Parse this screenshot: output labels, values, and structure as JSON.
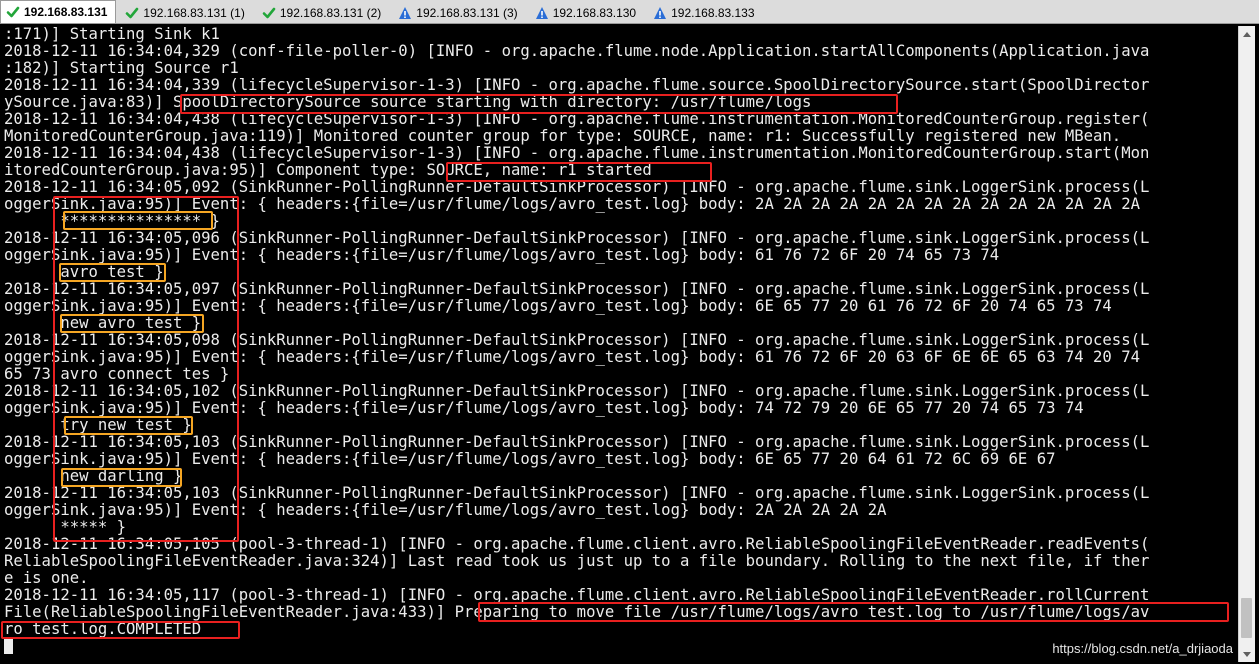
{
  "tabs": [
    {
      "label": "192.168.83.131",
      "status": "ok",
      "active": true
    },
    {
      "label": "192.168.83.131 (1)",
      "status": "ok",
      "active": false
    },
    {
      "label": "192.168.83.131 (2)",
      "status": "ok",
      "active": false
    },
    {
      "label": "192.168.83.131 (3)",
      "status": "warning",
      "active": false
    },
    {
      "label": "192.168.83.130",
      "status": "warning",
      "active": false
    },
    {
      "label": "192.168.83.133",
      "status": "warning",
      "active": false
    }
  ],
  "terminal": {
    "lines": [
      ":171)] Starting Sink k1",
      "2018-12-11 16:34:04,329 (conf-file-poller-0) [INFO - org.apache.flume.node.Application.startAllComponents(Application.java",
      ":182)] Starting Source r1",
      "2018-12-11 16:34:04,339 (lifecycleSupervisor-1-3) [INFO - org.apache.flume.source.SpoolDirectorySource.start(SpoolDirector",
      "ySource.java:83)] SpoolDirectorySource source starting with directory: /usr/flume/logs",
      "2018-12-11 16:34:04,438 (lifecycleSupervisor-1-3) [INFO - org.apache.flume.instrumentation.MonitoredCounterGroup.register(",
      "MonitoredCounterGroup.java:119)] Monitored counter group for type: SOURCE, name: r1: Successfully registered new MBean.",
      "2018-12-11 16:34:04,438 (lifecycleSupervisor-1-3) [INFO - org.apache.flume.instrumentation.MonitoredCounterGroup.start(Mon",
      "itoredCounterGroup.java:95)] Component type: SOURCE, name: r1 started",
      "2018-12-11 16:34:05,092 (SinkRunner-PollingRunner-DefaultSinkProcessor) [INFO - org.apache.flume.sink.LoggerSink.process(L",
      "oggerSink.java:95)] Event: { headers:{file=/usr/flume/logs/avro_test.log} body: 2A 2A 2A 2A 2A 2A 2A 2A 2A 2A 2A 2A 2A 2A",
      "      *************** }",
      "2018-12-11 16:34:05,096 (SinkRunner-PollingRunner-DefaultSinkProcessor) [INFO - org.apache.flume.sink.LoggerSink.process(L",
      "oggerSink.java:95)] Event: { headers:{file=/usr/flume/logs/avro_test.log} body: 61 76 72 6F 20 74 65 73 74",
      "      avro test }",
      "2018-12-11 16:34:05,097 (SinkRunner-PollingRunner-DefaultSinkProcessor) [INFO - org.apache.flume.sink.LoggerSink.process(L",
      "oggerSink.java:95)] Event: { headers:{file=/usr/flume/logs/avro_test.log} body: 6E 65 77 20 61 76 72 6F 20 74 65 73 74",
      "      new avro test }",
      "2018-12-11 16:34:05,098 (SinkRunner-PollingRunner-DefaultSinkProcessor) [INFO - org.apache.flume.sink.LoggerSink.process(L",
      "oggerSink.java:95)] Event: { headers:{file=/usr/flume/logs/avro_test.log} body: 61 76 72 6F 20 63 6F 6E 6E 65 63 74 20 74",
      "65 73 avro connect tes }",
      "2018-12-11 16:34:05,102 (SinkRunner-PollingRunner-DefaultSinkProcessor) [INFO - org.apache.flume.sink.LoggerSink.process(L",
      "oggerSink.java:95)] Event: { headers:{file=/usr/flume/logs/avro_test.log} body: 74 72 79 20 6E 65 77 20 74 65 73 74",
      "      try new test }",
      "2018-12-11 16:34:05,103 (SinkRunner-PollingRunner-DefaultSinkProcessor) [INFO - org.apache.flume.sink.LoggerSink.process(L",
      "oggerSink.java:95)] Event: { headers:{file=/usr/flume/logs/avro_test.log} body: 6E 65 77 20 64 61 72 6C 69 6E 67",
      "      new darling }",
      "2018-12-11 16:34:05,103 (SinkRunner-PollingRunner-DefaultSinkProcessor) [INFO - org.apache.flume.sink.LoggerSink.process(L",
      "oggerSink.java:95)] Event: { headers:{file=/usr/flume/logs/avro_test.log} body: 2A 2A 2A 2A 2A",
      "      ***** }",
      "2018-12-11 16:34:05,105 (pool-3-thread-1) [INFO - org.apache.flume.client.avro.ReliableSpoolingFileEventReader.readEvents(",
      "ReliableSpoolingFileEventReader.java:324)] Last read took us just up to a file boundary. Rolling to the next file, if ther",
      "e is one.",
      "2018-12-11 16:34:05,117 (pool-3-thread-1) [INFO - org.apache.flume.client.avro.ReliableSpoolingFileEventReader.rollCurrent",
      "File(ReliableSpoolingFileEventReader.java:433)] Preparing to move file /usr/flume/logs/avro_test.log to /usr/flume/logs/av",
      "ro_test.log.COMPLETED"
    ]
  },
  "watermark": "https://blog.csdn.net/a_drjiaoda",
  "colors": {
    "red_highlight": "#e8201f",
    "orange_highlight": "#f5a623",
    "ok_icon": "#22a63a",
    "warn_icon": "#2a6dd6"
  }
}
